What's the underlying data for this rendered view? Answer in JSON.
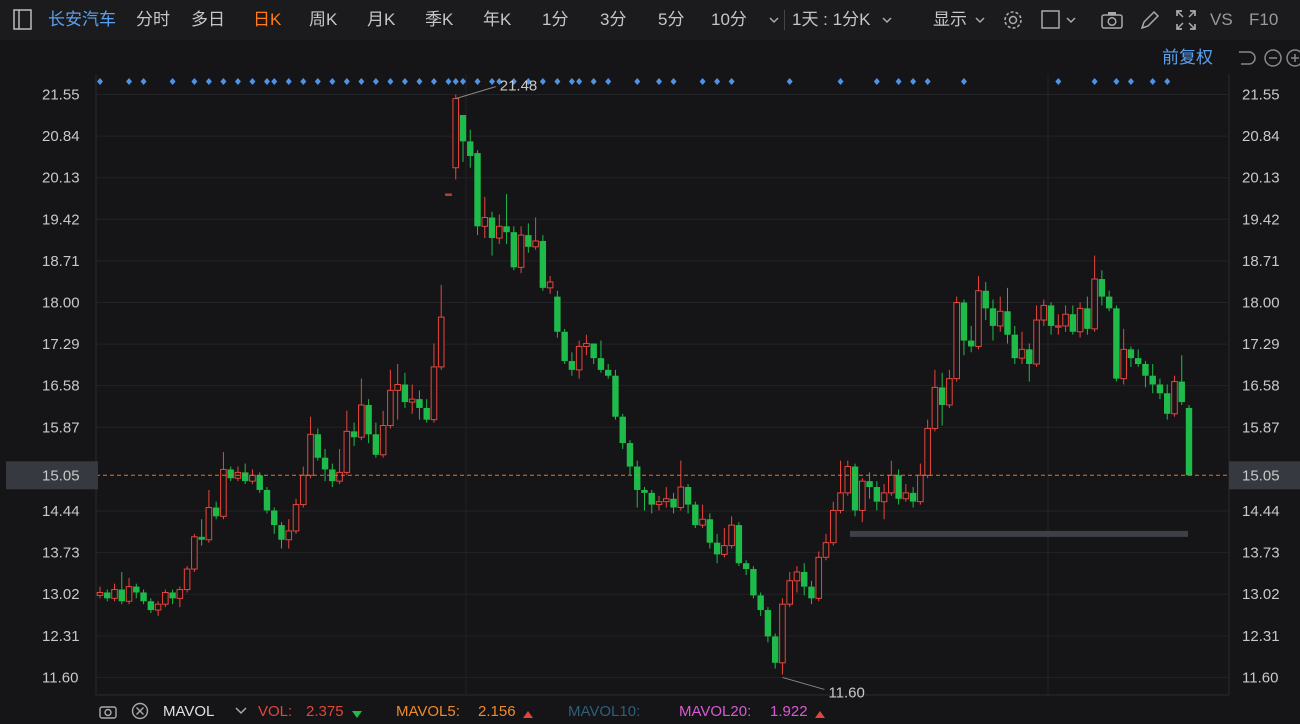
{
  "toolbar": {
    "stock_name": "长安汽车",
    "tabs": [
      "分时",
      "多日",
      "日K",
      "周K",
      "月K",
      "季K",
      "年K",
      "1分",
      "3分",
      "5分",
      "10分"
    ],
    "active_tab": "日K",
    "period_select": "1天 : 1分K",
    "display_label": "显示",
    "vs_label": "VS",
    "f10_label": "F10"
  },
  "subbar": {
    "adjust_label": "前复权"
  },
  "price_axis": {
    "labels": [
      "21.55",
      "20.84",
      "20.13",
      "19.42",
      "18.71",
      "18.00",
      "17.29",
      "16.58",
      "15.87",
      "15.05",
      "14.44",
      "13.73",
      "13.02",
      "12.31",
      "11.60"
    ],
    "current": "15.05"
  },
  "annotations": {
    "high": "21.48",
    "low": "11.60"
  },
  "colors": {
    "up": "#e8453c",
    "down": "#1fbb4a",
    "accent": "#ff7a1a",
    "marker": "#4f93e8",
    "bg": "#151517"
  },
  "chart_data": {
    "type": "candlestick",
    "y_range": [
      11.3,
      21.9
    ],
    "current_price": 15.05,
    "high": 21.48,
    "low": 11.6,
    "candles": [
      [
        13.0,
        13.05,
        13.15,
        12.95
      ],
      [
        13.05,
        12.95,
        13.1,
        12.9
      ],
      [
        12.95,
        13.1,
        13.2,
        12.9
      ],
      [
        13.1,
        12.9,
        13.4,
        12.85
      ],
      [
        12.9,
        13.15,
        13.3,
        12.85
      ],
      [
        13.15,
        13.05,
        13.2,
        12.95
      ],
      [
        13.05,
        12.9,
        13.1,
        12.85
      ],
      [
        12.9,
        12.75,
        12.95,
        12.7
      ],
      [
        12.75,
        12.85,
        12.9,
        12.65
      ],
      [
        12.85,
        13.05,
        13.1,
        12.8
      ],
      [
        13.05,
        12.95,
        13.1,
        12.85
      ],
      [
        12.95,
        13.1,
        13.15,
        12.8
      ],
      [
        13.1,
        13.45,
        13.5,
        13.05
      ],
      [
        13.45,
        14.0,
        14.05,
        13.4
      ],
      [
        14.0,
        13.95,
        14.3,
        13.85
      ],
      [
        13.95,
        14.5,
        14.8,
        13.9
      ],
      [
        14.5,
        14.35,
        14.6,
        14.3
      ],
      [
        14.35,
        15.15,
        15.45,
        14.3
      ],
      [
        15.15,
        15.0,
        15.2,
        14.95
      ],
      [
        15.0,
        15.1,
        15.2,
        14.95
      ],
      [
        15.1,
        14.95,
        15.25,
        14.9
      ],
      [
        14.95,
        15.05,
        15.15,
        14.9
      ],
      [
        15.05,
        14.8,
        15.1,
        14.75
      ],
      [
        14.8,
        14.45,
        14.85,
        14.4
      ],
      [
        14.45,
        14.2,
        14.5,
        14.05
      ],
      [
        14.2,
        13.95,
        14.25,
        13.8
      ],
      [
        13.95,
        14.1,
        14.3,
        13.8
      ],
      [
        14.1,
        14.55,
        14.65,
        14.05
      ],
      [
        14.55,
        15.05,
        15.2,
        14.5
      ],
      [
        15.05,
        15.75,
        16.05,
        15.0
      ],
      [
        15.75,
        15.35,
        15.85,
        15.3
      ],
      [
        15.35,
        15.15,
        15.5,
        14.95
      ],
      [
        15.15,
        14.95,
        15.25,
        14.85
      ],
      [
        14.95,
        15.1,
        15.5,
        14.9
      ],
      [
        15.1,
        15.8,
        16.15,
        15.05
      ],
      [
        15.8,
        15.7,
        15.95,
        15.55
      ],
      [
        15.7,
        16.25,
        16.7,
        15.65
      ],
      [
        16.25,
        15.75,
        16.35,
        15.6
      ],
      [
        15.75,
        15.4,
        15.95,
        15.35
      ],
      [
        15.4,
        15.9,
        16.15,
        15.35
      ],
      [
        15.9,
        16.5,
        16.85,
        15.85
      ],
      [
        16.5,
        16.6,
        16.95,
        16.0
      ],
      [
        16.6,
        16.3,
        16.8,
        16.2
      ],
      [
        16.3,
        16.35,
        16.6,
        16.1
      ],
      [
        16.35,
        16.2,
        16.5,
        16.0
      ],
      [
        16.2,
        16.0,
        16.35,
        15.95
      ],
      [
        16.0,
        16.9,
        17.3,
        15.95
      ],
      [
        16.9,
        17.75,
        18.3,
        16.85
      ],
      [
        19.85,
        19.85,
        19.85,
        19.85
      ],
      [
        20.3,
        21.48,
        21.55,
        20.1
      ],
      [
        21.2,
        20.75,
        21.2,
        20.4
      ],
      [
        20.75,
        20.5,
        20.95,
        20.3
      ],
      [
        20.55,
        19.3,
        20.6,
        19.15
      ],
      [
        19.3,
        19.45,
        19.8,
        19.1
      ],
      [
        19.45,
        19.1,
        19.55,
        18.8
      ],
      [
        19.1,
        19.3,
        19.5,
        19.0
      ],
      [
        19.3,
        19.2,
        19.85,
        19.0
      ],
      [
        19.2,
        18.6,
        19.3,
        18.55
      ],
      [
        18.6,
        19.15,
        19.3,
        18.5
      ],
      [
        19.15,
        18.95,
        19.35,
        18.85
      ],
      [
        18.95,
        19.05,
        19.45,
        18.9
      ],
      [
        19.05,
        18.25,
        19.15,
        18.2
      ],
      [
        18.25,
        18.35,
        18.45,
        18.15
      ],
      [
        18.1,
        17.5,
        18.2,
        17.4
      ],
      [
        17.5,
        17.0,
        17.55,
        16.95
      ],
      [
        17.0,
        16.85,
        17.15,
        16.75
      ],
      [
        16.85,
        17.25,
        17.35,
        16.7
      ],
      [
        17.25,
        17.3,
        17.45,
        17.1
      ],
      [
        17.3,
        17.05,
        17.3,
        16.95
      ],
      [
        17.05,
        16.85,
        17.35,
        16.8
      ],
      [
        16.85,
        16.75,
        16.95,
        16.7
      ],
      [
        16.75,
        16.05,
        16.85,
        16.0
      ],
      [
        16.05,
        15.6,
        16.1,
        15.5
      ],
      [
        15.6,
        15.2,
        15.65,
        15.05
      ],
      [
        15.2,
        14.8,
        15.3,
        14.5
      ],
      [
        14.8,
        14.75,
        14.85,
        14.45
      ],
      [
        14.75,
        14.55,
        14.8,
        14.4
      ],
      [
        14.55,
        14.6,
        14.7,
        14.45
      ],
      [
        14.6,
        14.65,
        14.85,
        14.5
      ],
      [
        14.65,
        14.5,
        14.75,
        14.4
      ],
      [
        14.5,
        14.85,
        15.3,
        14.45
      ],
      [
        14.85,
        14.55,
        14.9,
        14.4
      ],
      [
        14.55,
        14.2,
        14.6,
        14.15
      ],
      [
        14.2,
        14.3,
        14.55,
        14.15
      ],
      [
        14.3,
        13.9,
        14.4,
        13.8
      ],
      [
        13.9,
        13.7,
        14.05,
        13.55
      ],
      [
        13.7,
        13.85,
        14.15,
        13.65
      ],
      [
        13.85,
        14.2,
        14.35,
        13.8
      ],
      [
        14.2,
        13.55,
        14.25,
        13.5
      ],
      [
        13.55,
        13.45,
        13.6,
        13.35
      ],
      [
        13.45,
        13.0,
        13.5,
        12.95
      ],
      [
        13.0,
        12.75,
        13.05,
        12.65
      ],
      [
        12.75,
        12.3,
        12.8,
        12.2
      ],
      [
        12.3,
        11.85,
        12.35,
        11.75
      ],
      [
        11.85,
        12.85,
        12.95,
        11.65
      ],
      [
        12.85,
        13.25,
        13.4,
        12.8
      ],
      [
        13.25,
        13.4,
        13.5,
        13.05
      ],
      [
        13.4,
        13.15,
        13.55,
        13.0
      ],
      [
        13.15,
        12.95,
        13.25,
        12.85
      ],
      [
        12.95,
        13.65,
        13.75,
        12.9
      ],
      [
        13.65,
        13.9,
        14.05,
        13.6
      ],
      [
        13.9,
        14.45,
        14.6,
        13.85
      ],
      [
        14.45,
        14.75,
        15.3,
        14.4
      ],
      [
        14.75,
        15.2,
        15.3,
        14.7
      ],
      [
        15.2,
        14.45,
        15.25,
        14.35
      ],
      [
        14.45,
        14.95,
        15.0,
        14.25
      ],
      [
        14.95,
        14.85,
        15.1,
        14.65
      ],
      [
        14.85,
        14.6,
        14.95,
        14.45
      ],
      [
        14.6,
        14.75,
        14.9,
        14.3
      ],
      [
        14.75,
        15.05,
        15.3,
        14.7
      ],
      [
        15.05,
        14.65,
        15.15,
        14.55
      ],
      [
        14.65,
        14.75,
        14.9,
        14.6
      ],
      [
        14.75,
        14.6,
        14.85,
        14.5
      ],
      [
        14.6,
        15.05,
        15.25,
        14.55
      ],
      [
        15.05,
        15.85,
        16.0,
        15.0
      ],
      [
        15.85,
        16.55,
        16.85,
        15.8
      ],
      [
        16.55,
        16.25,
        16.8,
        15.9
      ],
      [
        16.25,
        16.7,
        16.85,
        16.2
      ],
      [
        16.7,
        18.0,
        18.1,
        16.65
      ],
      [
        18.0,
        17.35,
        18.05,
        17.1
      ],
      [
        17.35,
        17.25,
        17.6,
        17.15
      ],
      [
        17.25,
        18.2,
        18.45,
        17.2
      ],
      [
        18.2,
        17.9,
        18.35,
        17.7
      ],
      [
        17.9,
        17.6,
        18.05,
        17.35
      ],
      [
        17.6,
        17.85,
        18.1,
        17.5
      ],
      [
        17.85,
        17.45,
        18.25,
        17.3
      ],
      [
        17.45,
        17.05,
        17.6,
        16.95
      ],
      [
        17.05,
        17.2,
        17.5,
        16.95
      ],
      [
        17.2,
        16.95,
        17.3,
        16.65
      ],
      [
        16.95,
        17.7,
        17.95,
        16.9
      ],
      [
        17.7,
        17.95,
        18.05,
        17.6
      ],
      [
        17.95,
        17.6,
        18.0,
        17.45
      ],
      [
        17.6,
        17.6,
        17.8,
        17.45
      ],
      [
        17.6,
        17.8,
        17.95,
        17.5
      ],
      [
        17.8,
        17.5,
        17.95,
        17.45
      ],
      [
        17.5,
        17.9,
        18.0,
        17.4
      ],
      [
        17.9,
        17.55,
        18.1,
        17.45
      ],
      [
        17.55,
        18.4,
        18.8,
        17.5
      ],
      [
        18.4,
        18.1,
        18.55,
        17.95
      ],
      [
        18.1,
        17.9,
        18.2,
        17.85
      ],
      [
        17.9,
        16.7,
        17.95,
        16.65
      ],
      [
        16.7,
        17.2,
        17.55,
        16.6
      ],
      [
        17.2,
        17.05,
        17.25,
        16.9
      ],
      [
        17.05,
        16.95,
        17.2,
        16.9
      ],
      [
        16.95,
        16.75,
        17.0,
        16.55
      ],
      [
        16.75,
        16.6,
        16.95,
        16.45
      ],
      [
        16.6,
        16.45,
        16.7,
        16.35
      ],
      [
        16.45,
        16.1,
        16.6,
        16.0
      ],
      [
        16.1,
        16.65,
        16.75,
        16.05
      ],
      [
        16.65,
        16.3,
        17.1,
        16.25
      ],
      [
        16.2,
        15.05,
        16.25,
        15.05
      ]
    ],
    "overlay_line": 14.05
  },
  "bottom": {
    "indicator": "MAVOL",
    "vol_label": "VOL:",
    "vol_value": "2.375",
    "mavol5_label": "MAVOL5:",
    "mavol5_value": "2.156",
    "mavol10_label": "MAVOL10:",
    "mavol20_label": "MAVOL20:",
    "mavol20_value": "1.922"
  }
}
